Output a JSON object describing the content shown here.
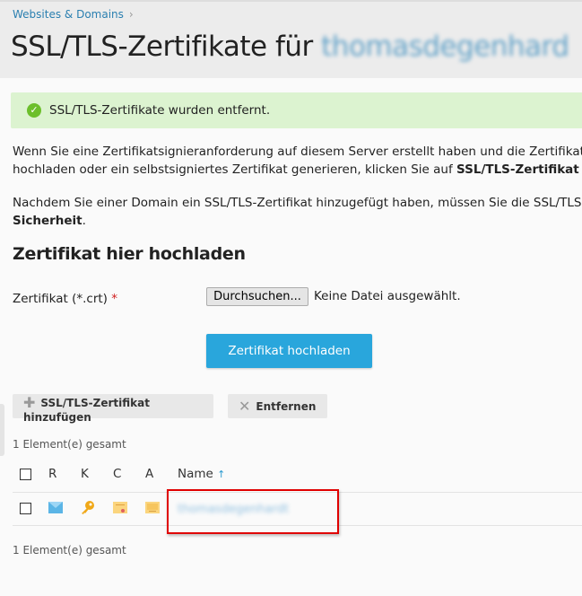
{
  "breadcrumb": {
    "item": "Websites & Domains",
    "separator": "›"
  },
  "header": {
    "title": "SSL/TLS-Zertifikate für",
    "domain": "thomasdegenhard"
  },
  "alert": {
    "message": "SSL/TLS-Zertifikate wurden entfernt.",
    "color": "#dcf3d0"
  },
  "intro": {
    "p1_line1": "Wenn Sie eine Zertifikatsignieranforderung auf diesem Server erstellt haben und die Zertifikatsdat",
    "p1_line2": "hochladen oder ein selbstsigniertes Zertifikat generieren, klicken Sie auf ",
    "p1_bold": "SSL/TLS-Zertifikat hinzuf",
    "p2_line1": "Nachdem Sie einer Domain ein SSL/TLS-Zertifikat hinzugefügt haben, müssen Sie die SSL/TLS-Unte",
    "p2_bold": "Sicherheit",
    "p2_end": "."
  },
  "upload": {
    "heading": "Zertifikat hier hochladen",
    "label": "Zertifikat (*.crt)",
    "required": "*",
    "browse": "Durchsuchen...",
    "no_file": "Keine Datei ausgewählt.",
    "submit": "Zertifikat hochladen",
    "accent": "#29a6dc"
  },
  "toolbar": {
    "add": "SSL/TLS-Zertifikat hinzufügen",
    "remove": "Entfernen"
  },
  "list": {
    "total_top": "1 Element(e) gesamt",
    "total_bottom": "1 Element(e) gesamt",
    "columns": [
      "R",
      "K",
      "C",
      "A",
      "Name"
    ],
    "sort_icon": "↑",
    "rows": [
      {
        "name": "thomasdegenhardt",
        "icons": [
          "envelope-icon",
          "key-icon",
          "certificate-icon",
          "ca-icon"
        ]
      }
    ]
  }
}
